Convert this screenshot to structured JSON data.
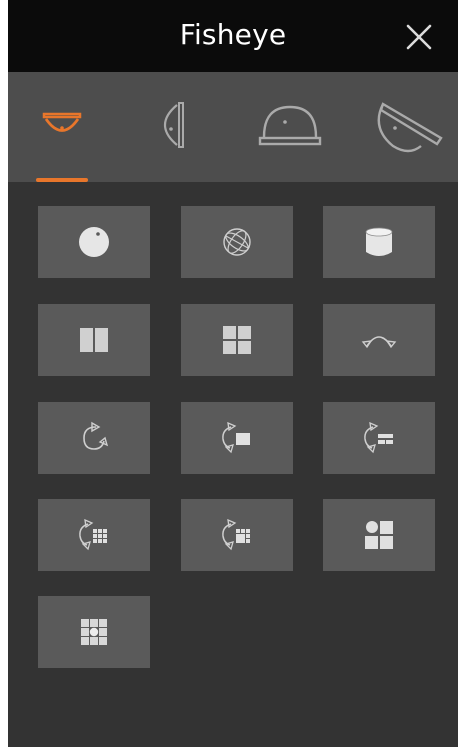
{
  "panel": {
    "title": "Fisheye",
    "close_icon": "close-icon"
  },
  "mount_tabs": {
    "selected_index": 0,
    "accent_color": "#e8762b",
    "items": [
      {
        "name": "ceiling-mount",
        "icon": "ceiling-mount-icon",
        "selected": true
      },
      {
        "name": "wall-mount",
        "icon": "wall-mount-icon",
        "selected": false
      },
      {
        "name": "table-mount",
        "icon": "table-mount-icon",
        "selected": false
      },
      {
        "name": "tilted-mount",
        "icon": "tilted-mount-icon",
        "selected": false
      }
    ]
  },
  "display_modes": [
    {
      "icon": "fisheye-original-icon"
    },
    {
      "icon": "globe-view-icon"
    },
    {
      "icon": "cylinder-view-icon"
    },
    {
      "icon": "two-split-icon"
    },
    {
      "icon": "four-split-icon"
    },
    {
      "icon": "panorama-360-icon"
    },
    {
      "icon": "rotate-view-icon"
    },
    {
      "icon": "rotate-single-view-icon"
    },
    {
      "icon": "rotate-dual-view-icon"
    },
    {
      "icon": "rotate-grid-view-icon"
    },
    {
      "icon": "rotate-multi-view-icon"
    },
    {
      "icon": "one-plus-three-layout-icon"
    },
    {
      "icon": "fisheye-plus-eight-layout-icon"
    }
  ]
}
